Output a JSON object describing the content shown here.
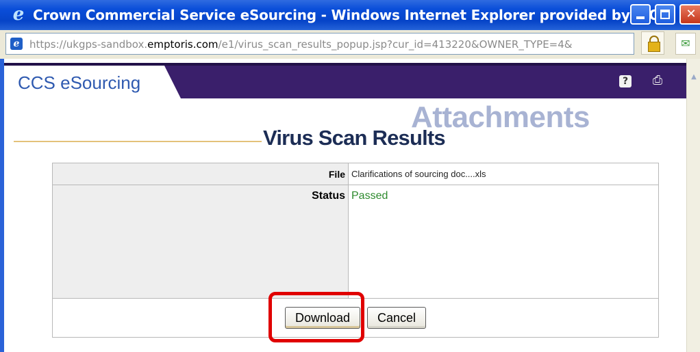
{
  "window": {
    "title": "Crown Commercial Service eSourcing - Windows Internet Explorer provided by ITC",
    "ie_icon": "ie-logo-icon",
    "minimize_icon": "minimize-icon",
    "maximize_icon": "maximize-icon",
    "close_icon": "close-icon"
  },
  "address": {
    "url_prefix": "https://ukgps-sandbox.",
    "url_host": "emptoris.com",
    "url_suffix": "/e1/virus_scan_results_popup.jsp?cur_id=413220&OWNER_TYPE=4&",
    "lock_icon": "padlock-icon"
  },
  "brand": {
    "name": "CCS eSourcing",
    "help_label": "?",
    "colors": {
      "bar": "#3a1f6b",
      "brand_text": "#2f5ab0"
    }
  },
  "page": {
    "section_title": "Attachments",
    "title": "Virus Scan Results"
  },
  "results": {
    "file_label": "File",
    "file_value": "Clarifications of sourcing doc....xls",
    "status_label": "Status",
    "status_value": "Passed",
    "status_color": "#2d8a2d"
  },
  "actions": {
    "download_label": "Download",
    "cancel_label": "Cancel"
  }
}
